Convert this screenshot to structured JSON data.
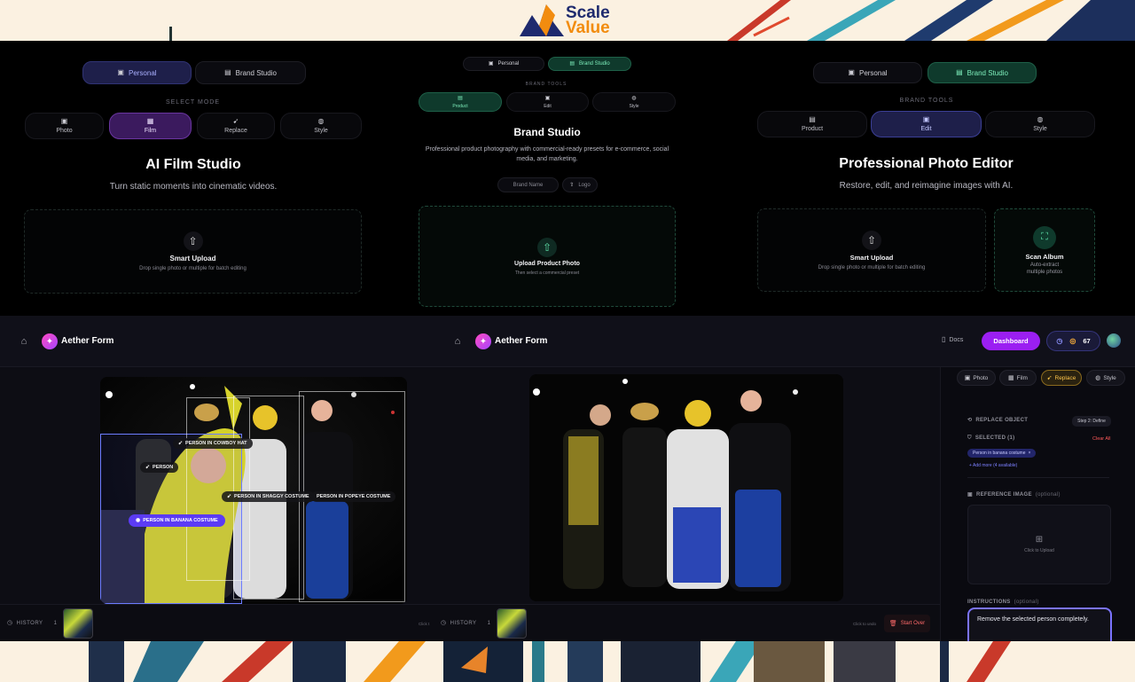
{
  "banner": {
    "logo_word1": "Scale",
    "logo_word2": "Value",
    "accent_orange": "#f28c0f",
    "accent_navy": "#1e2a6e"
  },
  "panel1": {
    "tabs": [
      "Personal",
      "Brand Studio"
    ],
    "mode_label": "SELECT MODE",
    "modes": [
      "Photo",
      "Film",
      "Replace",
      "Style"
    ],
    "title": "AI Film Studio",
    "subtitle": "Turn static moments into cinematic videos.",
    "upload_title": "Smart Upload",
    "upload_sub": "Drop single photo or multiple for batch editing"
  },
  "panel2": {
    "tabs": [
      "Personal",
      "Brand Studio"
    ],
    "tools_label": "BRAND TOOLS",
    "tools": [
      "Product",
      "Edit",
      "Style"
    ],
    "title": "Brand Studio",
    "subtitle": "Professional product photography with commercial-ready presets for e-commerce, social media, and marketing.",
    "brand_name": "Brand Name",
    "logo": "Logo",
    "upload_title": "Upload Product Photo",
    "upload_sub": "Then select a commercial preset"
  },
  "panel3": {
    "tabs": [
      "Personal",
      "Brand Studio"
    ],
    "tools_label": "BRAND TOOLS",
    "tools": [
      "Product",
      "Edit",
      "Style"
    ],
    "title": "Professional Photo Editor",
    "subtitle": "Restore, edit, and reimagine images with AI.",
    "upload_title": "Smart Upload",
    "upload_sub": "Drop single photo or multiple for batch editing",
    "scan_title": "Scan Album",
    "scan_sub1": "Auto-extract",
    "scan_sub2": "multiple photos"
  },
  "editor": {
    "brand": "Aether Form",
    "docs": "Docs",
    "dashboard": "Dashboard",
    "credits": "67",
    "history": "HISTORY",
    "history_count": "1",
    "click_hint_left": "Click t",
    "click_hint_right": "Click to undo",
    "start_over": "Start Over",
    "detections": [
      "PERSON IN COWBOY HAT",
      "PERSON",
      "PERSON IN SHAGGY COSTUME",
      "PERSON IN POPEYE COSTUME",
      "PERSON IN BANANA COSTUME"
    ]
  },
  "right_panel": {
    "tabs": [
      "Photo",
      "Film",
      "Replace",
      "Style"
    ],
    "replace_object": "REPLACE OBJECT",
    "step": "Step 2: Define",
    "selected": "SELECTED (1)",
    "clear_all": "Clear All",
    "selected_chip": "Person in banana costume",
    "add_more": "+ Add more (4 available)",
    "reference_image": "REFERENCE IMAGE",
    "optional": "(optional)",
    "click_upload": "Click to Upload",
    "instructions": "INSTRUCTIONS",
    "instructions_optional": "(optional)",
    "instruction_text": "Remove the selected person completely."
  }
}
